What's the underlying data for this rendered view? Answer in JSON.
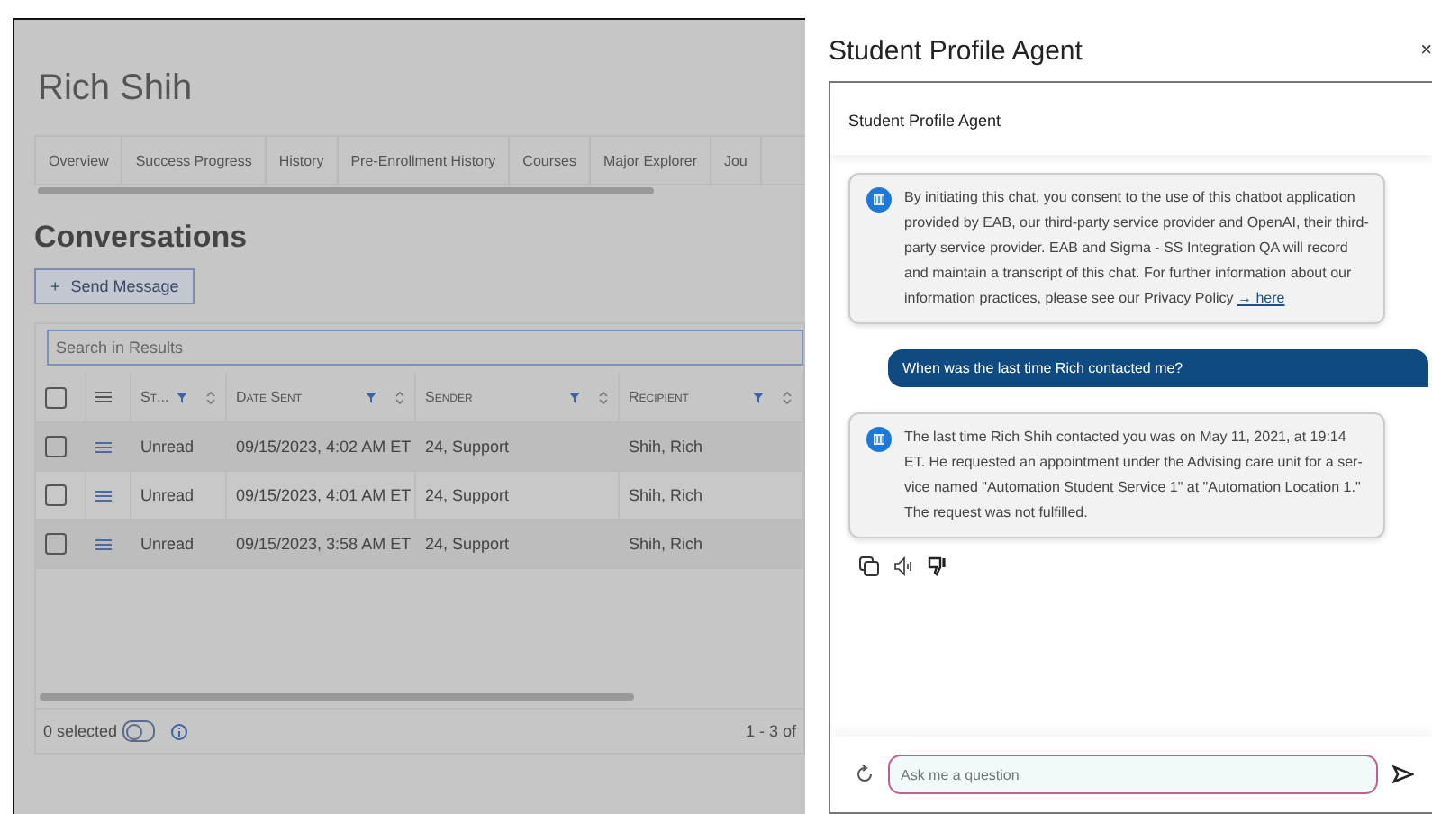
{
  "page": {
    "title": "Rich Shih",
    "tabs": [
      {
        "label": "Overview"
      },
      {
        "label": "Success Progress"
      },
      {
        "label": "History"
      },
      {
        "label": "Pre-Enrollment History"
      },
      {
        "label": "Courses"
      },
      {
        "label": "Major Explorer"
      },
      {
        "label": "Jou"
      }
    ],
    "section_title": "Conversations",
    "send_button": {
      "icon": "+",
      "label": "Send Message"
    },
    "table": {
      "search": {
        "placeholder": "Search in Results"
      },
      "header_checked": false,
      "columns": [
        {
          "label": "St..."
        },
        {
          "label": "Date Sent"
        },
        {
          "label": "Sender"
        },
        {
          "label": "Recipient"
        }
      ],
      "rows": [
        {
          "checked": false,
          "cells": [
            "Unread",
            "09/15/2023, 4:02 AM ET",
            "24, Support",
            "Shih, Rich"
          ]
        },
        {
          "checked": false,
          "cells": [
            "Unread",
            "09/15/2023, 4:01 AM ET",
            "24, Support",
            "Shih, Rich"
          ]
        },
        {
          "checked": false,
          "cells": [
            "Unread",
            "09/15/2023, 3:58 AM ET",
            "24, Support",
            "Shih, Rich"
          ]
        }
      ],
      "selected_count": "0 selected",
      "toggle_on": false,
      "pagination": "1 - 3 of"
    }
  },
  "agent": {
    "title": "Student Profile Agent",
    "close": "×",
    "header": "Student Profile Agent",
    "messages": [
      {
        "kind": "bot",
        "text": "By initiating this chat, you consent to the use of this chatbot application provided by EAB, our third-party service provider and OpenAI, their third-party service provider. EAB and Sigma - SS Integration QA will record and maintain a transcript of this chat. For further information about our information practices, please see our Privacy Policy",
        "link": "→ here"
      },
      {
        "kind": "user",
        "text": "When was the last time Rich contacted me?"
      },
      {
        "kind": "bot",
        "text": "The last time Rich Shih contacted you was on May 11, 2021, at 19:14 ET. He requested an appointment under the Advising care unit for a ser-vice named \"Automation Student Service 1\" at \"Automation Location 1.\" The request was not fulfilled."
      }
    ],
    "input": {
      "placeholder": "Ask me a question"
    }
  }
}
